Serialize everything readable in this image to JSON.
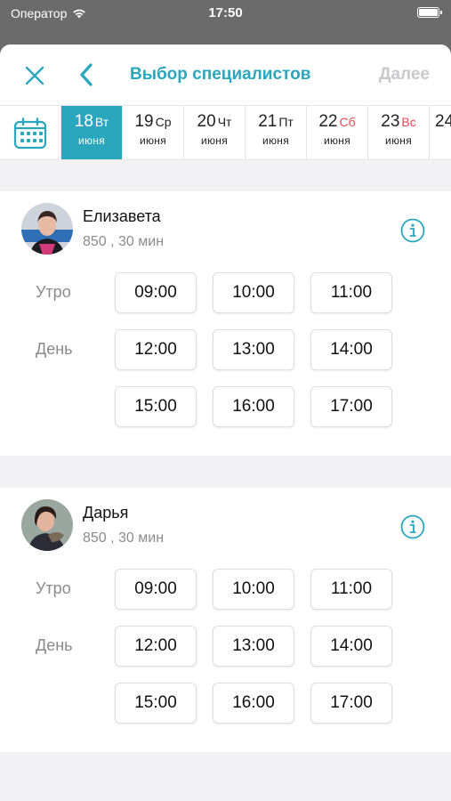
{
  "status_bar": {
    "carrier": "Оператор",
    "time": "17:50"
  },
  "nav": {
    "title": "Выбор специалистов",
    "next_label": "Далее"
  },
  "colors": {
    "accent": "#2aa6bd",
    "weekend": "#e5484d",
    "disabled": "#c9c9cc"
  },
  "dates": [
    {
      "num": "18",
      "weekday": "Вт",
      "month": "июня",
      "selected": true,
      "weekend": false
    },
    {
      "num": "19",
      "weekday": "Ср",
      "month": "июня",
      "selected": false,
      "weekend": false
    },
    {
      "num": "20",
      "weekday": "Чт",
      "month": "июня",
      "selected": false,
      "weekend": false
    },
    {
      "num": "21",
      "weekday": "Пт",
      "month": "июня",
      "selected": false,
      "weekend": false
    },
    {
      "num": "22",
      "weekday": "Сб",
      "month": "июня",
      "selected": false,
      "weekend": true
    },
    {
      "num": "23",
      "weekday": "Вс",
      "month": "июня",
      "selected": false,
      "weekend": true
    },
    {
      "num": "24",
      "weekday": "",
      "month": "",
      "selected": false,
      "weekend": false
    }
  ],
  "specialists": [
    {
      "name": "Елизавета",
      "meta": "850 , 30 мин",
      "rows": [
        {
          "label": "Утро",
          "slots": [
            "09:00",
            "10:00",
            "11:00"
          ]
        },
        {
          "label": "День",
          "slots": [
            "12:00",
            "13:00",
            "14:00"
          ]
        },
        {
          "label": "",
          "slots": [
            "15:00",
            "16:00",
            "17:00"
          ]
        }
      ]
    },
    {
      "name": "Дарья",
      "meta": "850 , 30 мин",
      "rows": [
        {
          "label": "Утро",
          "slots": [
            "09:00",
            "10:00",
            "11:00"
          ]
        },
        {
          "label": "День",
          "slots": [
            "12:00",
            "13:00",
            "14:00"
          ]
        },
        {
          "label": "",
          "slots": [
            "15:00",
            "16:00",
            "17:00"
          ]
        }
      ]
    }
  ],
  "icons": {
    "close": "close-icon",
    "back": "chevron-left-icon",
    "calendar": "calendar-icon",
    "info": "info-icon",
    "wifi": "wifi-icon",
    "battery": "battery-icon"
  }
}
